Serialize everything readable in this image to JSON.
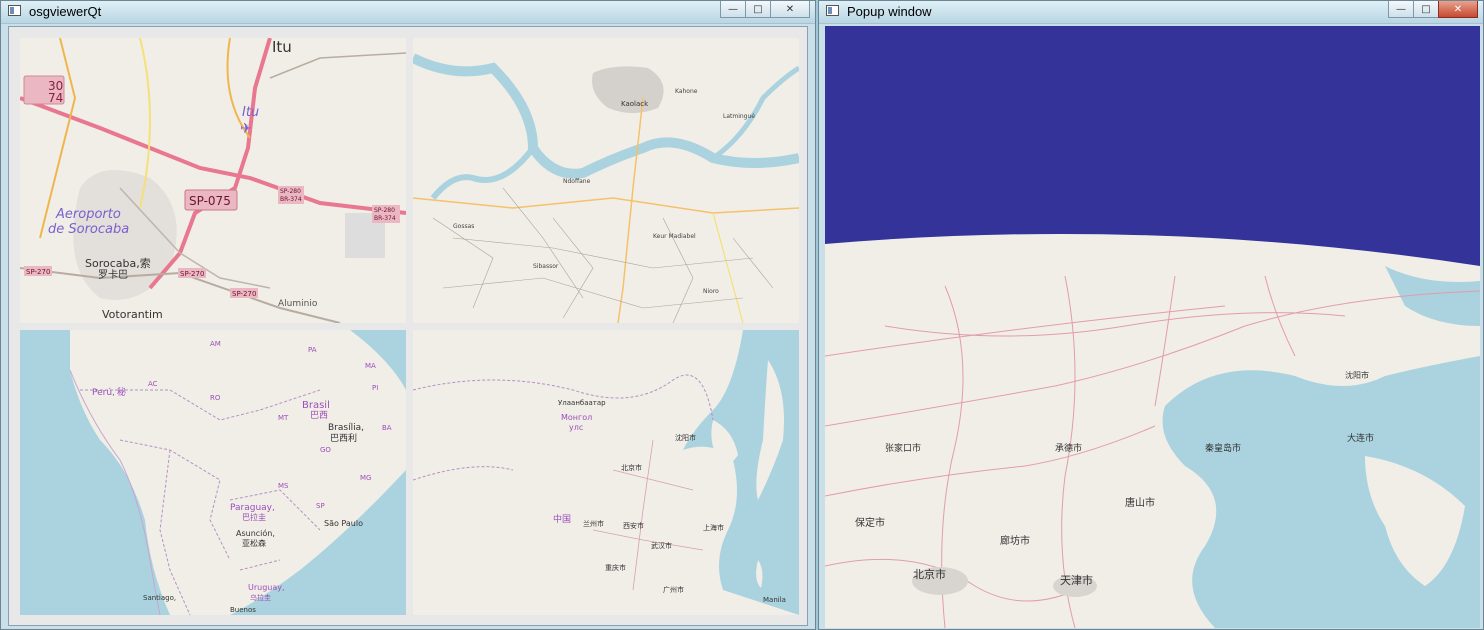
{
  "windows": {
    "main": {
      "title": "osgviewerQt",
      "controls": {
        "minimize": "—",
        "maximize": "□",
        "close": "✕"
      }
    },
    "popup": {
      "title": "Popup window",
      "controls": {
        "minimize": "—",
        "maximize": "□",
        "close": "✕"
      }
    }
  },
  "views": {
    "sorocaba": {
      "city_top": "Itu",
      "airport_itu": "Itu",
      "airport_label_1": "Aeroporto",
      "airport_label_2": "de Sorocaba",
      "road_sp075": "SP-075",
      "city": "Sorocaba,索",
      "city_cn": "罗卡巴",
      "votorantim": "Votorantim",
      "aluminio": "Aluminio",
      "sp270": "SP-270",
      "sp280": "SP-280",
      "br374": "BR-374",
      "badge_top_1": "30",
      "badge_top_2": "74"
    },
    "africa_town": {
      "town": "Kaolack",
      "labels": [
        "Kahone",
        "Ndoffane",
        "Latmingué",
        "Gossas",
        "Sibassor",
        "Keur Madiabel",
        "Nioro"
      ]
    },
    "south_america": {
      "brasil": "Brasil",
      "brasil_cn": "巴西",
      "brasilia": "Brasília,",
      "brasilia_cn": "巴西利",
      "peru": "Perú,",
      "peru_cn": "秘",
      "paraguay": "Paraguay,",
      "paraguay_cn": "巴拉圭",
      "asuncion": "Asunción,",
      "asuncion_cn": "亚松森",
      "sao_paulo": "São Paulo",
      "uruguay": "Uruguay,",
      "uruguay_cn": "乌拉圭",
      "buenos_aires": "Buenos",
      "santiago": "Santiago,",
      "states": [
        "AM",
        "PA",
        "MA",
        "AC",
        "RO",
        "MT",
        "GO",
        "MG",
        "MS",
        "SP",
        "PI",
        "BA"
      ]
    },
    "east_asia": {
      "mongolia_1": "Улаанбаатар",
      "mongolia_2": "Монгол",
      "mongolia_3": "улс",
      "china": "中国",
      "beijing": "北京市",
      "shanghai": "上海市",
      "wuhan": "武汉市",
      "chongqing": "重庆市",
      "guangzhou": "广州市",
      "xian": "西安市",
      "lanzhou": "兰州市",
      "shenyang": "沈阳市",
      "manila": "Manila"
    },
    "globe": {
      "sky_color": "#33339a",
      "cities": [
        "北京市",
        "天津市",
        "大连市",
        "沈阳市",
        "唐山市",
        "保定市",
        "廊坊市",
        "秦皇岛市",
        "承德市",
        "张家口市"
      ]
    }
  }
}
